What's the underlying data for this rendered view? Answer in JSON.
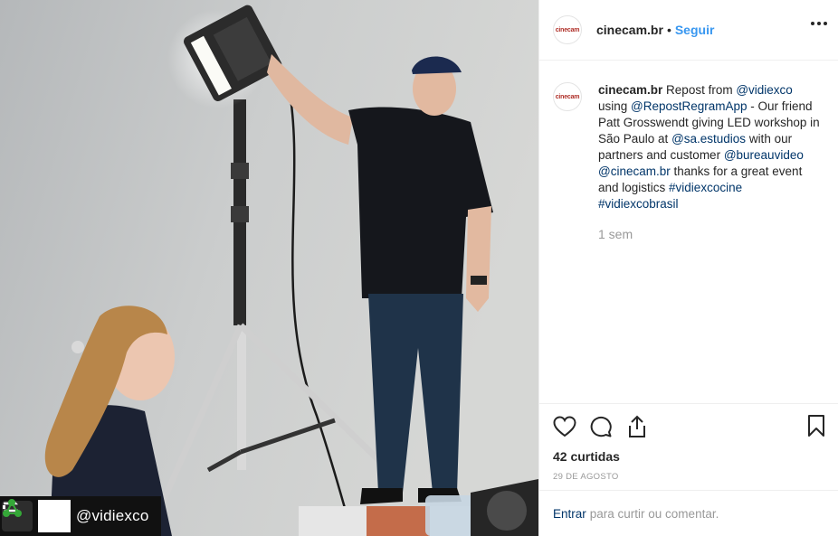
{
  "post": {
    "username": "cinecam.br",
    "avatar_text": "cinecam",
    "follow_label": "Seguir",
    "separator": "•",
    "more_icon": "more-horizontal-icon"
  },
  "photo": {
    "description_icon": "photo",
    "repost_handle": "@vidiexco"
  },
  "caption": {
    "username": "cinecam.br",
    "segments": [
      {
        "text": " Repost from ",
        "link": false
      },
      {
        "text": "@vidiexco",
        "link": true
      },
      {
        "text": " using ",
        "link": false
      },
      {
        "text": "@RepostRegramApp",
        "link": true
      },
      {
        "text": " - Our friend Patt Grosswendt giving LED workshop in São Paulo at ",
        "link": false
      },
      {
        "text": "@sa.estudios",
        "link": true
      },
      {
        "text": " with our partners and customer ",
        "link": false
      },
      {
        "text": "@bureauvideo",
        "link": true
      },
      {
        "text": " ",
        "link": false
      },
      {
        "text": "@cinecam.br",
        "link": true
      },
      {
        "text": " thanks for a great event and logistics ",
        "link": false
      },
      {
        "text": "#vidiexcocine",
        "link": true
      },
      {
        "text": " ",
        "link": false
      },
      {
        "text": "#vidiexcobrasil",
        "link": true
      }
    ],
    "time_ago": "1 sem"
  },
  "actions": {
    "likes": "42 curtidas",
    "date": "29 DE AGOSTO"
  },
  "comment": {
    "login_label": "Entrar",
    "prompt": "para curtir ou comentar."
  },
  "colors": {
    "link": "#003569",
    "follow": "#3897f0",
    "muted": "#999999",
    "border": "#efefef"
  }
}
